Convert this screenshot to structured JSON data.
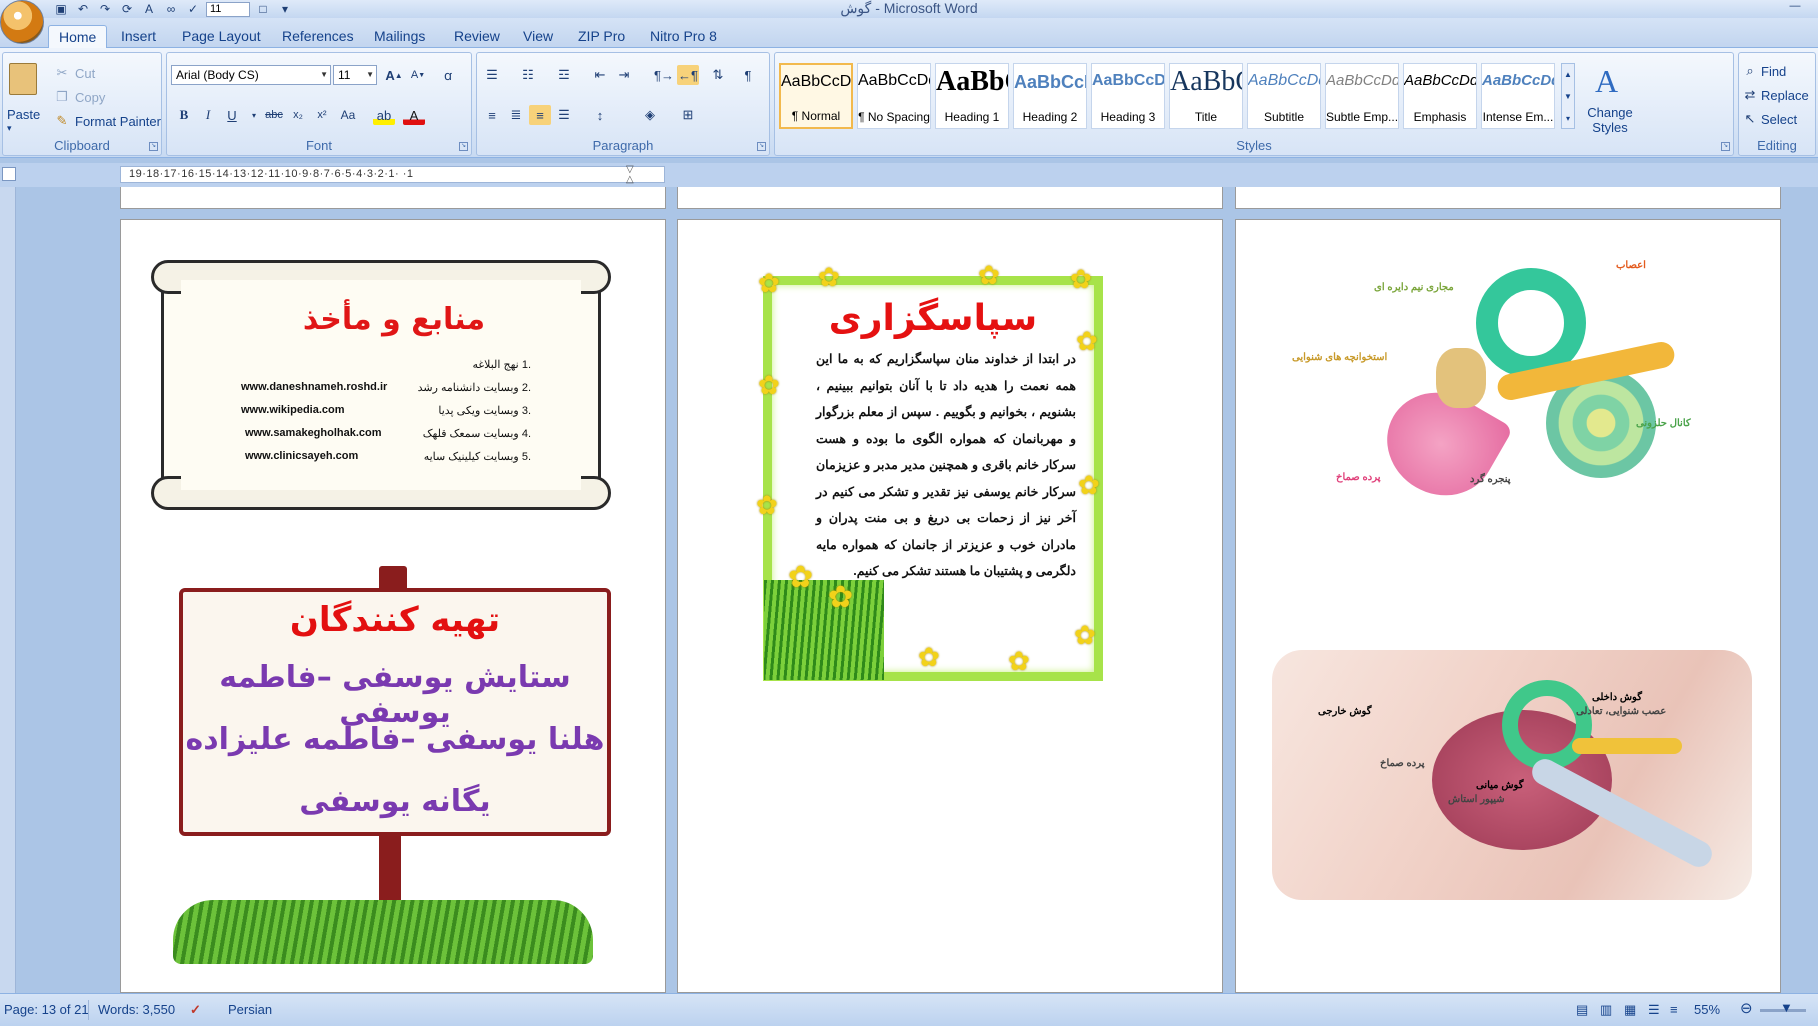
{
  "window": {
    "title": "گوش - Microsoft Word",
    "font_size_value": "11"
  },
  "tabs": [
    "Home",
    "Insert",
    "Page Layout",
    "References",
    "Mailings",
    "Review",
    "View",
    "ZIP Pro",
    "Nitro Pro 8"
  ],
  "clipboard": {
    "paste": "Paste",
    "cut": "Cut",
    "copy": "Copy",
    "format_painter": "Format Painter",
    "label": "Clipboard"
  },
  "font": {
    "name": "Arial (Body CS)",
    "size": "11",
    "label": "Font"
  },
  "paragraph": {
    "label": "Paragraph"
  },
  "styles": {
    "label": "Styles",
    "items": [
      {
        "preview": "AaBbCcDdEe",
        "name": "¶ Normal"
      },
      {
        "preview": "AaBbCcDdEe",
        "name": "¶ No Spacing"
      },
      {
        "preview": "AaBbCc",
        "name": "Heading 1"
      },
      {
        "preview": "AaBbCcDdEe",
        "name": "Heading 2"
      },
      {
        "preview": "AaBbCcDdEe",
        "name": "Heading 3"
      },
      {
        "preview": "AaBbCcDdEe",
        "name": "Title"
      },
      {
        "preview": "AaBbCcDdEe",
        "name": "Subtitle"
      },
      {
        "preview": "AaBbCcDdEe",
        "name": "Subtle Emp..."
      },
      {
        "preview": "AaBbCcDdEe",
        "name": "Emphasis"
      },
      {
        "preview": "AaBbCcDdEe",
        "name": "Intense Em..."
      }
    ],
    "change_styles": "Change Styles"
  },
  "editing": {
    "find": "Find",
    "replace": "Replace",
    "select": "Select",
    "label": "Editing"
  },
  "ruler": {
    "ticks": "19·18·17·16·15·14·13·12·11·10·9·8·7·6·5·4·3·2·1· ·1"
  },
  "pages": {
    "sources": {
      "title": "منابع و مأخذ",
      "items": [
        {
          "num": ".1",
          "label": "نهج البلاغه",
          "url": ""
        },
        {
          "num": ".2",
          "label": "وبسایت دانشنامه رشد",
          "url": "www.daneshnameh.roshd.ir"
        },
        {
          "num": ".3",
          "label": "وبسایت ویکی پدیا",
          "url": "www.wikipedia.com"
        },
        {
          "num": ".4",
          "label": "وبسایت سمعک قلهک",
          "url": "www.samakegholhak.com"
        },
        {
          "num": ".5",
          "label": "وبسایت کیلینیک سایه",
          "url": "www.clinicsayeh.com"
        }
      ]
    },
    "authors": {
      "title": "تهیه کنندگان",
      "lines": [
        "ستایش یوسفی –فاطمه یوسفی",
        "هلنا یوسفی –فاطمه علیزاده",
        "یگانه یوسفی"
      ]
    },
    "thanks": {
      "title": "سپاسگزاری",
      "body": "در ابتدا از خداوند منان سپاسگزاریم که به ما این همه نعمت را هدیه داد تا با آنان بتوانیم ببینیم ، بشنویم ، بخوانیم و بگوییم . سپس از معلم بزرگوار و مهربانمان که همواره الگوی ما بوده و هست سرکار خانم باقری و همچنین مدیر مدبر و عزیزمان سرکار خانم یوسفی نیز تقدیر و تشکر می کنیم در آخر نیز از زحمات بی دریغ و بی منت پدران و مادران خوب و عزیزتر از جانمان که همواره مایه دلگرمی و پشتیبان ما هستند تشکر می کنیم."
    },
    "ear_inner": {
      "labels": [
        "اعصاب",
        "مجاری نیم دایره ای",
        "استخوانچه های شنوایی",
        "کانال حلزونی",
        "پرده صماخ",
        "پنجره گرد"
      ]
    },
    "ear_outer": {
      "labels": [
        "گوش داخلی",
        "گوش خارجی",
        "پرده صماخ",
        "گوش میانی",
        "شیپور استاش",
        "عصب شنوایی، تعادلی"
      ]
    }
  },
  "status": {
    "page": "Page: 13 of 21",
    "words": "Words: 3,550",
    "language": "Persian",
    "zoom": "55%"
  },
  "colors": {
    "ribbon_bg": "#dbe7f7",
    "doc_bg": "#abc5e6",
    "title_red": "#e01616",
    "author_purple": "#7a3ab0",
    "sign_border": "#8a1d1d"
  }
}
